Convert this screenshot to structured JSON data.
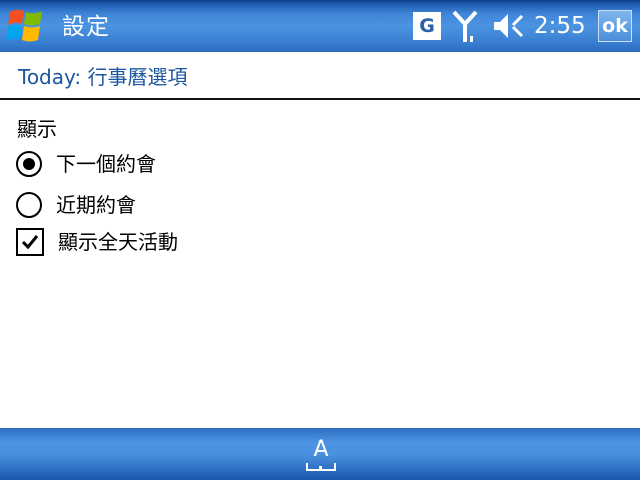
{
  "titlebar": {
    "title": "設定",
    "clock": "2:55",
    "ok_label": "ok",
    "status_g_label": "G",
    "icons": [
      "windows-start-icon",
      "signal-icon",
      "volume-icon"
    ]
  },
  "header": {
    "prefix": "Today:",
    "title": " 行事曆選項"
  },
  "display_section": {
    "label": "顯示",
    "options": [
      {
        "label": "下一個約會",
        "type": "radio",
        "checked": true
      },
      {
        "label": "近期約會",
        "type": "radio",
        "checked": false
      },
      {
        "label": "顯示全天活動",
        "type": "checkbox",
        "checked": true
      }
    ]
  },
  "menubar": {
    "input_panel_label": "A"
  },
  "colors": {
    "bar_blue": "#4b94e2",
    "header_text": "#1b56a0",
    "text": "#000000"
  }
}
